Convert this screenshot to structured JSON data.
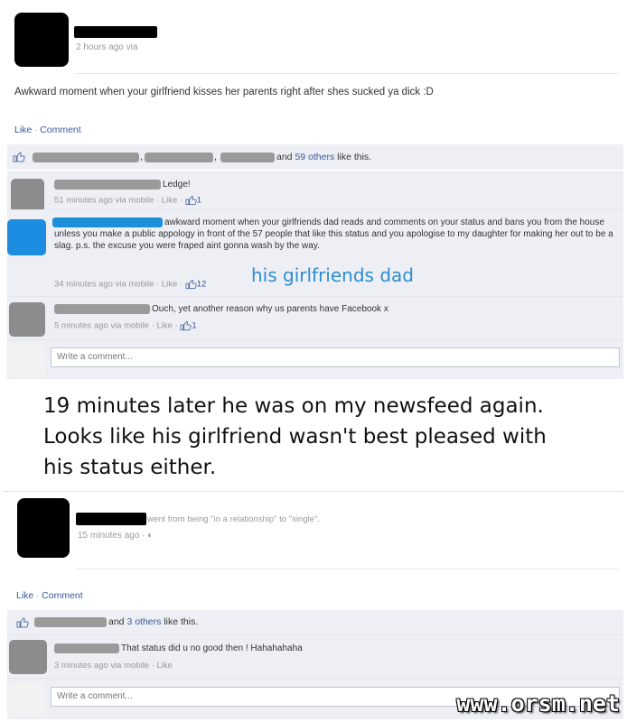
{
  "post1": {
    "time_meta": "2 hours ago via",
    "status_text": "Awkward moment when your girlfriend kisses her parents right after shes sucked ya dick :D",
    "actions": {
      "like": "Like",
      "sep": " · ",
      "comment": "Comment"
    },
    "likes": {
      "comma": ",",
      "and": "and",
      "others_link": "59 others",
      "suffix": "like this."
    },
    "comments": [
      {
        "text": "Ledge!",
        "meta": "51 minutes ago via mobile · Like · ",
        "likes": "1"
      },
      {
        "text": "awkward moment when your girlfriends dad reads and comments on your status and bans you from the house unless you make a public appology in front of the 57 people that like this status and you apologise to my daughter for making her out to be a slag. p.s. the excuse you were fraped aint gonna wash by the way.",
        "meta": "34 minutes ago via mobile · Like · ",
        "likes": "12"
      },
      {
        "text": "Ouch, yet another reason why us parents have Facebook x",
        "meta": "5 minutes ago via mobile · Like · ",
        "likes": "1"
      }
    ],
    "write_placeholder": "Write a comment..."
  },
  "annotation": "his girlfriends dad",
  "caption_lines": [
    "19 minutes later he was on my newsfeed again.",
    "Looks like his girlfriend wasn't best pleased with",
    "his status either."
  ],
  "post2": {
    "status_text": "went from being \"in a relationship\" to \"single\".",
    "time_meta": "15 minutes ago · ",
    "actions": {
      "like": "Like",
      "sep": " · ",
      "comment": "Comment"
    },
    "likes": {
      "and": "and",
      "others_link": "3 others",
      "suffix": "like this."
    },
    "comments": [
      {
        "text": "That status did u no good then ! Hahahahaha",
        "meta": "3 minutes ago via mobile · Like"
      }
    ],
    "write_placeholder": "Write a comment..."
  },
  "watermark": "www.orsm.net",
  "colors": {
    "link": "#3b5998",
    "panel": "#edeff4",
    "annotation": "#2b8ecf"
  }
}
